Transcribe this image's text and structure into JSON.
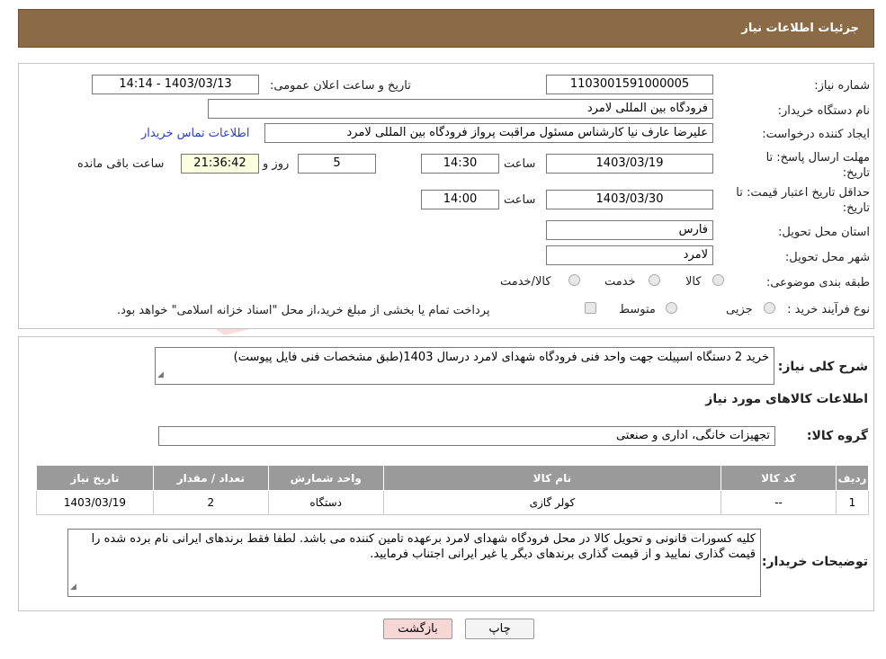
{
  "header": {
    "title": "جزئیات اطلاعات نیاز"
  },
  "form": {
    "need_number_label": "شماره نیاز:",
    "need_number": "1103001591000005",
    "announce_label": "تاریخ و ساعت اعلان عمومی:",
    "announce_value": "1403/03/13 - 14:14",
    "buyer_label": "نام دستگاه خریدار:",
    "buyer_value": "فرودگاه بین المللی لامرد",
    "requester_label": "ایجاد کننده درخواست:",
    "requester_value": "علیرضا عارف نیا کارشناس مسئول مراقبت پرواز فرودگاه بین المللی لامرد",
    "contact_link": "اطلاعات تماس خریدار",
    "deadline_label_1": "مهلت ارسال پاسخ: تا",
    "deadline_label_2": "تاریخ:",
    "deadline_date": "1403/03/19",
    "time_label": "ساعت",
    "deadline_time": "14:30",
    "days_value": "5",
    "days_label": "روز و",
    "remaining_time": "21:36:42",
    "remaining_label": "ساعت باقی مانده",
    "validity_label_1": "حداقل تاریخ اعتبار قیمت: تا",
    "validity_label_2": "تاریخ:",
    "validity_date": "1403/03/30",
    "validity_time": "14:00",
    "province_label": "استان محل تحویل:",
    "province_value": "فارس",
    "city_label": "شهر محل تحویل:",
    "city_value": "لامرد",
    "category_label": "طبقه بندی موضوعی:",
    "category_options": [
      "کالا",
      "خدمت",
      "کالا/خدمت"
    ],
    "process_label": "نوع فرآیند خرید :",
    "process_options": [
      "جزیی",
      "متوسط"
    ],
    "process_note": "پرداخت تمام یا بخشی از مبلغ خرید،از محل \"اسناد خزانه اسلامی\" خواهد بود."
  },
  "summary": {
    "label": "شرح کلی نیاز:",
    "text": "خرید 2 دستگاه اسپیلت  جهت واحد فنی  فرودگاه شهدای لامرد درسال 1403(طبق مشخصات فنی فایل پیوست)"
  },
  "goods_info": {
    "title": "اطلاعات کالاهای مورد نیاز"
  },
  "goods_group": {
    "label": "گروه کالا:",
    "value": "تجهیزات خانگی، اداری و صنعتی"
  },
  "table": {
    "headers": [
      "ردیف",
      "کد کالا",
      "نام کالا",
      "واحد شمارش",
      "تعداد / مقدار",
      "تاریخ نیاز"
    ],
    "rows": [
      [
        "1",
        "--",
        "کولر گازی",
        "دستگاه",
        "2",
        "1403/03/19"
      ]
    ]
  },
  "buyer_notes": {
    "label": "توضیحات خریدار:",
    "text": "کلیه کسورات قانونی و تحویل کالا در محل فرودگاه شهدای لامرد برعهده تامین کننده می باشد. لطفا فقط برندهای ایرانی نام برده شده را قیمت گذاری نمایید و از قیمت گذاری برندهای دیگر یا غیر ایرانی اجتناب فرمایید."
  },
  "buttons": {
    "print": "چاپ",
    "back": "بازگشت"
  },
  "colors": {
    "header_bg": "#8b6b45",
    "link": "#2a3fd0",
    "back_button_bg": "#f7d6d6"
  }
}
